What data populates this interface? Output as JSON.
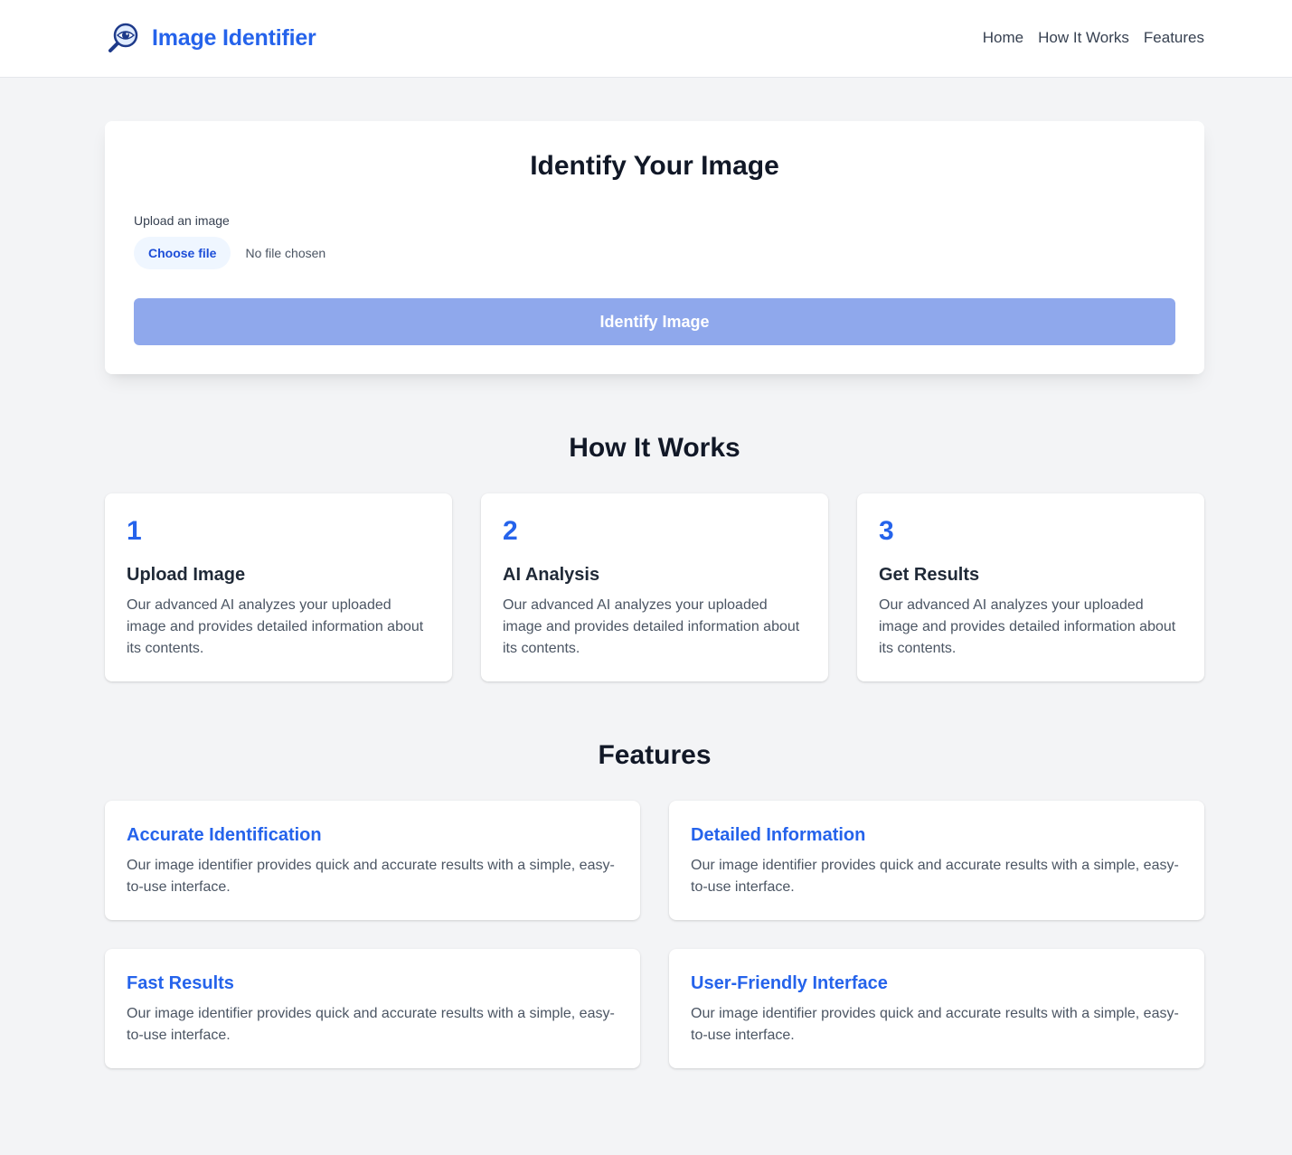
{
  "header": {
    "logo_icon": "magnifying-eye-icon",
    "title": "Image Identifier",
    "nav": [
      "Home",
      "How It Works",
      "Features"
    ]
  },
  "upload": {
    "title": "Identify Your Image",
    "label": "Upload an image",
    "choose_file": "Choose file",
    "file_status": "No file chosen",
    "submit": "Identify Image"
  },
  "how_it_works": {
    "title": "How It Works",
    "steps": [
      {
        "number": "1",
        "title": "Upload Image",
        "description": "Our advanced AI analyzes your uploaded image and provides detailed information about its contents."
      },
      {
        "number": "2",
        "title": "AI Analysis",
        "description": "Our advanced AI analyzes your uploaded image and provides detailed information about its contents."
      },
      {
        "number": "3",
        "title": "Get Results",
        "description": "Our advanced AI analyzes your uploaded image and provides detailed information about its contents."
      }
    ]
  },
  "features": {
    "title": "Features",
    "items": [
      {
        "title": "Accurate Identification",
        "description": "Our image identifier provides quick and accurate results with a simple, easy-to-use interface."
      },
      {
        "title": "Detailed Information",
        "description": "Our image identifier provides quick and accurate results with a simple, easy-to-use interface."
      },
      {
        "title": "Fast Results",
        "description": "Our image identifier provides quick and accurate results with a simple, easy-to-use interface."
      },
      {
        "title": "User-Friendly Interface",
        "description": "Our image identifier provides quick and accurate results with a simple, easy-to-use interface."
      }
    ]
  },
  "colors": {
    "accent": "#2563eb",
    "button_disabled": "#8fa8ec",
    "background": "#f3f4f6"
  }
}
